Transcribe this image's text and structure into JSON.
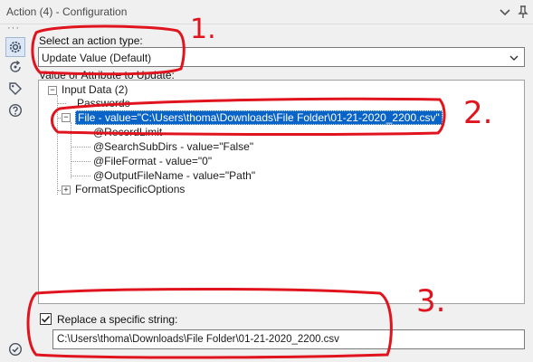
{
  "window": {
    "title": "Action (4) - Configuration"
  },
  "sidebar": {
    "items": [
      {
        "icon": "gear-icon"
      },
      {
        "icon": "refresh-icon"
      },
      {
        "icon": "tag-icon"
      },
      {
        "icon": "help-icon"
      }
    ],
    "bottom_icon": "check-circle-icon"
  },
  "action_type": {
    "label": "Select an action type:",
    "selected": "Update Value (Default)"
  },
  "tree": {
    "label": "Value or Attribute to Update:",
    "root": "Input Data (2)",
    "passwords": "Passwords",
    "file_node": "File - value=\"C:\\Users\\thoma\\Downloads\\File Folder\\01-21-2020_2200.csv\"",
    "children": [
      "@RecordLimit",
      "@SearchSubDirs - value=\"False\"",
      "@FileFormat - value=\"0\"",
      "@OutputFileName - value=\"Path\""
    ],
    "format_options": "FormatSpecificOptions"
  },
  "replace": {
    "label": "Replace a specific string:",
    "checked": true,
    "value": "C:\\Users\\thoma\\Downloads\\File Folder\\01-21-2020_2200.csv"
  },
  "annotations": [
    "1.",
    "2.",
    "3."
  ],
  "colors": {
    "selection": "#0a64c8",
    "annotation": "#e0141e"
  }
}
